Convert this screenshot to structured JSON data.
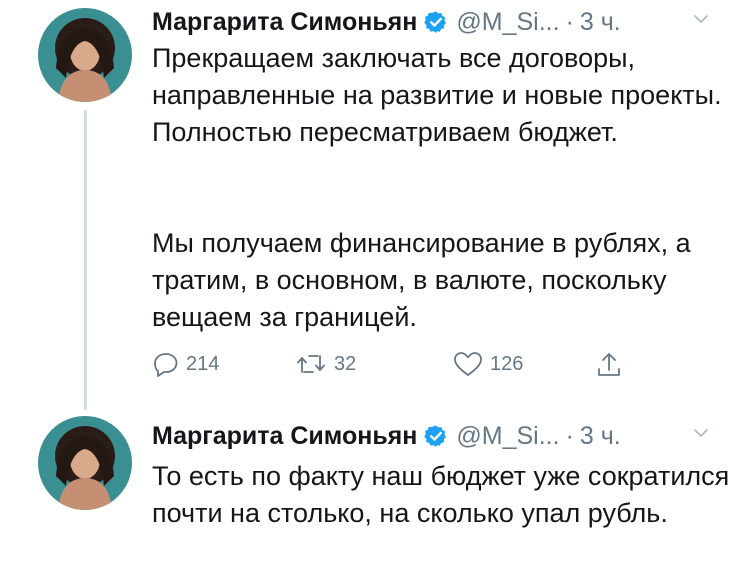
{
  "tweets": [
    {
      "author_name": "Маргарита Симоньян",
      "handle": "@M_Si...",
      "separator": "·",
      "time": "3 ч.",
      "paragraphs": [
        "Прекращаем заключать все договоры, направленные на развитие и новые проекты. Полностью пересматриваем бюджет.",
        "Мы получаем финансирование в рублях, а тратим, в основном, в валюте, поскольку вещаем за границей."
      ],
      "replies": "214",
      "retweets": "32",
      "likes": "126"
    },
    {
      "author_name": "Маргарита Симоньян",
      "handle": "@M_Si...",
      "separator": "·",
      "time": "3 ч.",
      "paragraphs": [
        "То есть по факту наш бюджет уже сократился почти на столько, на сколько упал рубль."
      ]
    }
  ],
  "icons": {
    "verified": "verified-badge-icon",
    "menu": "chevron-down-icon",
    "reply": "reply-icon",
    "retweet": "retweet-icon",
    "like": "heart-icon",
    "share": "share-icon"
  },
  "colors": {
    "text": "#14171a",
    "secondary": "#657786",
    "verified": "#1da1f2",
    "thread_line": "#cfd9de"
  }
}
